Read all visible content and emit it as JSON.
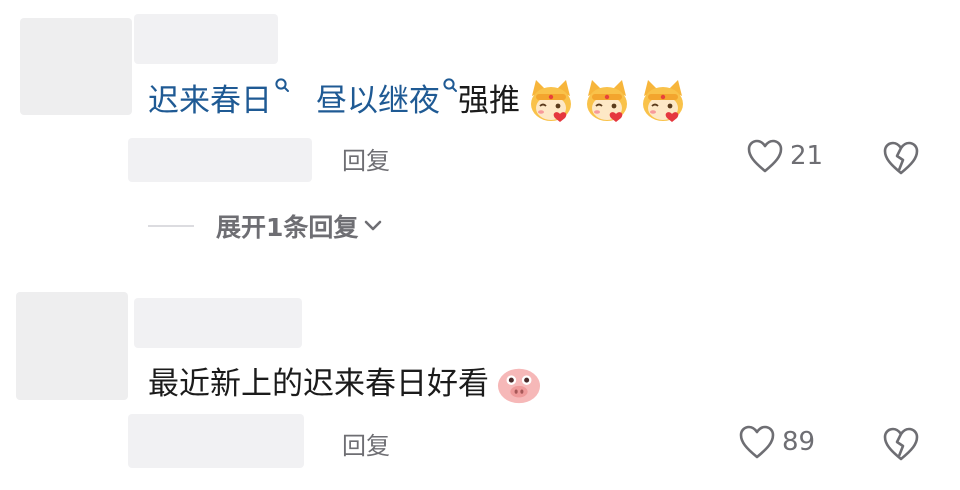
{
  "comments": [
    {
      "segments": {
        "tag1": "迟来春日",
        "tag2": "昼以继夜",
        "text": "强推"
      },
      "emojis": [
        "fox-heart-emoji",
        "fox-heart-emoji",
        "fox-heart-emoji"
      ],
      "reply_label": "回复",
      "like_count": "21",
      "expand_label": "展开1条回复"
    },
    {
      "text": "最近新上的迟来春日好看",
      "emojis": [
        "pig-face-emoji"
      ],
      "reply_label": "回复",
      "like_count": "89"
    }
  ],
  "colors": {
    "tag_link": "#1f5a94",
    "secondary_text": "#6e6e73",
    "placeholder": "#f1f1f3"
  }
}
